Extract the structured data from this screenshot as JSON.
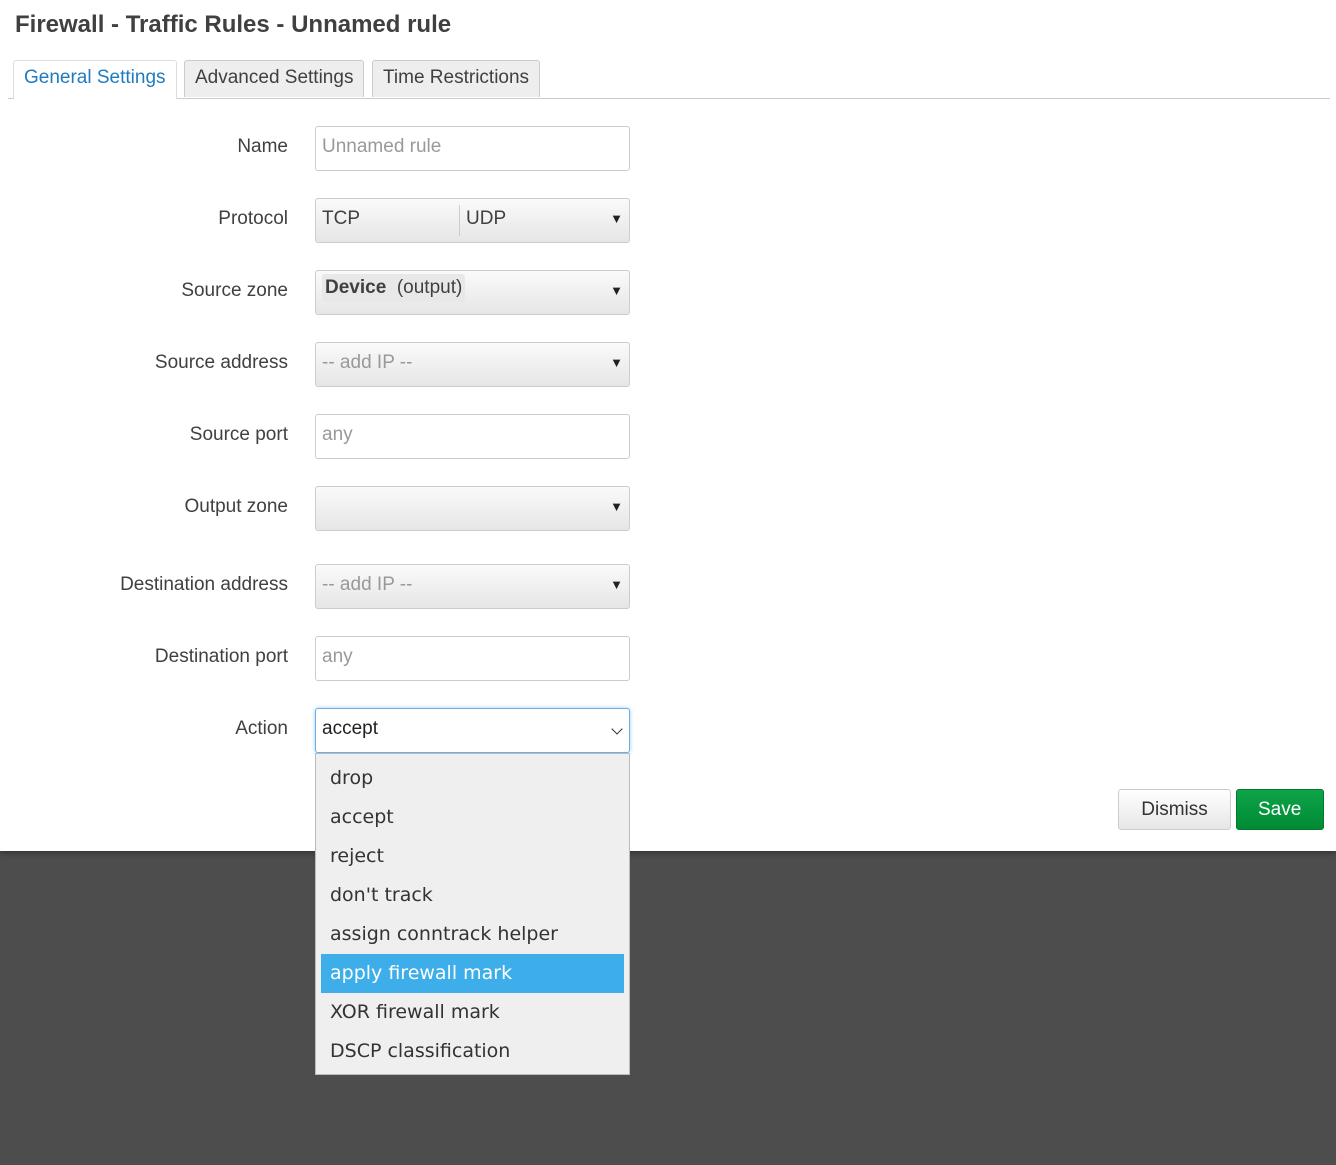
{
  "title": "Firewall - Traffic Rules - Unnamed rule",
  "tabs": [
    {
      "label": "General Settings",
      "active": true
    },
    {
      "label": "Advanced Settings",
      "active": false
    },
    {
      "label": "Time Restrictions",
      "active": false
    }
  ],
  "form": {
    "name": {
      "label": "Name",
      "placeholder": "Unnamed rule",
      "value": ""
    },
    "protocol": {
      "label": "Protocol",
      "values": [
        "TCP",
        "UDP"
      ]
    },
    "source_zone": {
      "label": "Source zone",
      "value_bold": "Device",
      "value_suffix": "(output)"
    },
    "source_address": {
      "label": "Source address",
      "placeholder": "-- add IP --"
    },
    "source_port": {
      "label": "Source port",
      "placeholder": "any"
    },
    "output_zone": {
      "label": "Output zone",
      "value": ""
    },
    "destination_address": {
      "label": "Destination address",
      "placeholder": "-- add IP --"
    },
    "destination_port": {
      "label": "Destination port",
      "placeholder": "any"
    },
    "action": {
      "label": "Action",
      "value": "accept",
      "options": [
        "drop",
        "accept",
        "reject",
        "don't track",
        "assign conntrack helper",
        "apply firewall mark",
        "XOR firewall mark",
        "DSCP classification"
      ],
      "highlighted": "apply firewall mark"
    }
  },
  "buttons": {
    "dismiss": "Dismiss",
    "save": "Save"
  },
  "colors": {
    "accent": "#1e7bc0",
    "save": "#0a9a41",
    "highlight": "#3daee9",
    "backdrop": "#4d4d4d"
  }
}
